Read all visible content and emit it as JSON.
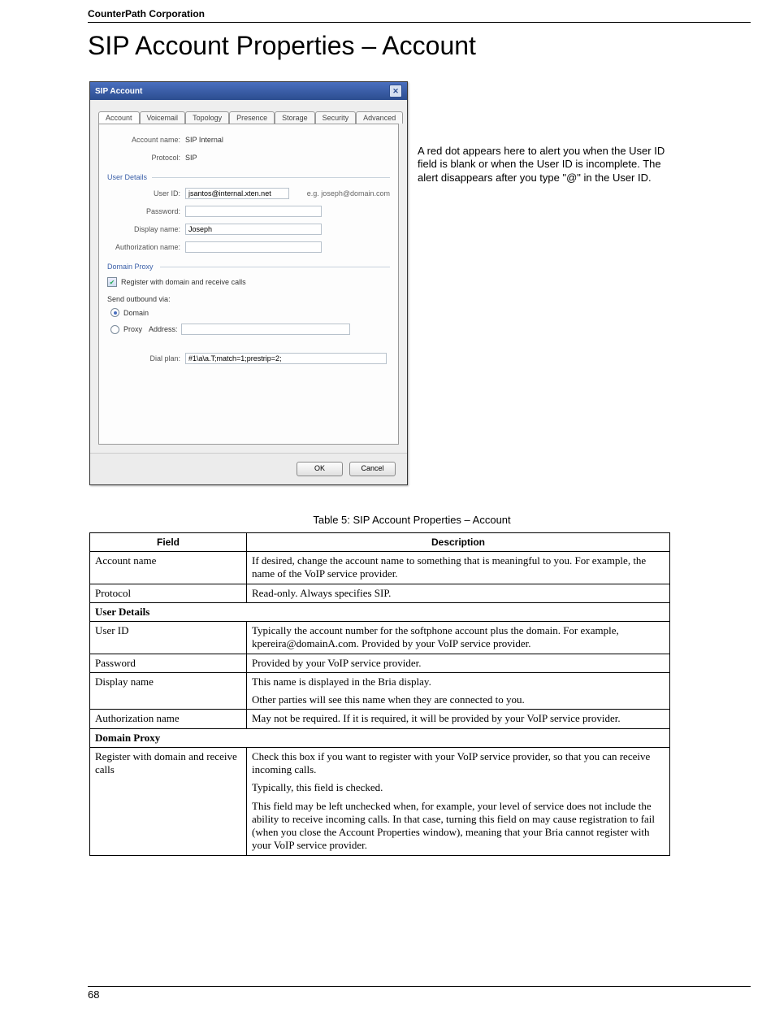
{
  "header": {
    "company": "CounterPath Corporation"
  },
  "heading": "SIP Account Properties – Account",
  "dialog": {
    "title": "SIP Account",
    "tabs": [
      "Account",
      "Voicemail",
      "Topology",
      "Presence",
      "Storage",
      "Security",
      "Advanced"
    ],
    "account_name_label": "Account name:",
    "account_name_value": "SIP Internal",
    "protocol_label": "Protocol:",
    "protocol_value": "SIP",
    "user_details_label": "User Details",
    "user_id_label": "User ID:",
    "user_id_value": "jsantos@internal.xten.net",
    "user_id_hint": "e.g. joseph@domain.com",
    "password_label": "Password:",
    "password_value": "",
    "display_name_label": "Display name:",
    "display_name_value": "Joseph",
    "auth_name_label": "Authorization name:",
    "auth_name_value": "",
    "domain_proxy_label": "Domain Proxy",
    "register_checkbox_label": "Register with domain and receive calls",
    "send_label": "Send outbound via:",
    "radio_domain_label": "Domain",
    "radio_proxy_label": "Proxy",
    "proxy_address_label": "Address:",
    "proxy_address_value": "",
    "dial_plan_label": "Dial plan:",
    "dial_plan_value": "#1\\a\\a.T;match=1;prestrip=2;",
    "ok_label": "OK",
    "cancel_label": "Cancel"
  },
  "note": "A red dot appears here to alert you when the User ID field is blank or when the User ID is incomplete. The alert disappears after you type \"@\" in the User ID.",
  "table": {
    "caption": "Table 5: SIP Account Properties – Account",
    "header_field": "Field",
    "header_desc": "Description",
    "rows": [
      {
        "field": "Account name",
        "desc": "If desired, change the account name to something that is meaningful to you. For example, the name of the VoIP service provider."
      },
      {
        "field": "Protocol",
        "desc": "Read-only. Always specifies SIP."
      },
      {
        "section": "User Details"
      },
      {
        "field": "User ID",
        "desc": "Typically the account number for the softphone account plus the domain. For example, kpereira@domainA.com. Provided by your VoIP service provider."
      },
      {
        "field": "Password",
        "desc": "Provided by your VoIP service provider."
      },
      {
        "field": "Display name",
        "desc_parts": [
          "This name is displayed in the Bria display.",
          "Other parties will see this name when they are connected to you."
        ]
      },
      {
        "field": "Authorization name",
        "desc": "May not be required. If it is required, it will be provided by your VoIP service provider."
      },
      {
        "section": "Domain Proxy"
      },
      {
        "field": "Register with domain and receive calls",
        "desc_parts": [
          "Check this box if you want to register with your VoIP service provider, so that you can receive incoming calls.",
          "Typically, this field is checked.",
          "This field may be left unchecked when, for example, your level of service does not include the ability to receive incoming calls. In that case, turning this field on may cause registration to fail (when you close the Account Properties window), meaning that your Bria cannot register with your VoIP service provider."
        ]
      }
    ]
  },
  "footer": {
    "page_number": "68"
  }
}
